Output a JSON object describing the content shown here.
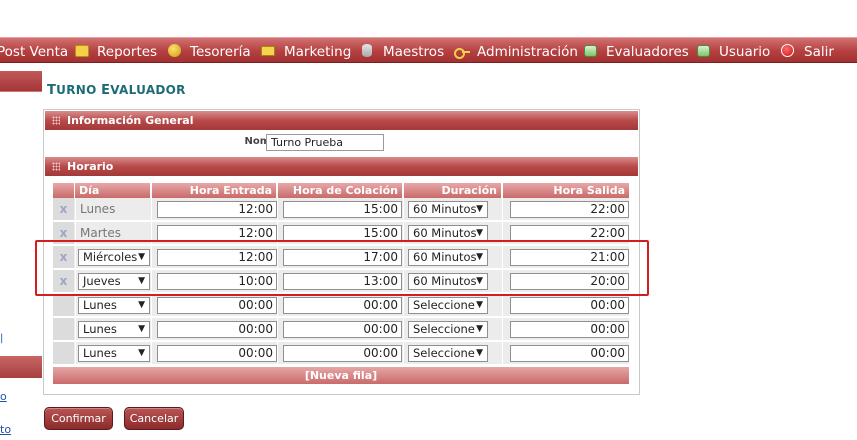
{
  "menu": [
    {
      "label": "Post Venta",
      "icon": "post-venta-icon"
    },
    {
      "label": "Reportes",
      "icon": "folder-icon"
    },
    {
      "label": "Tesorería",
      "icon": "coin-icon"
    },
    {
      "label": "Marketing",
      "icon": "marketing-icon"
    },
    {
      "label": "Maestros",
      "icon": "database-icon"
    },
    {
      "label": "Administración",
      "icon": "key-icon"
    },
    {
      "label": "Evaluadores",
      "icon": "evaluator-icon"
    },
    {
      "label": "Usuario",
      "icon": "user-icon"
    },
    {
      "label": "Salir",
      "icon": "exit-icon"
    }
  ],
  "sidebar": {
    "link1": "o",
    "link2": "to",
    "tick": "|"
  },
  "page": {
    "title_first": "T",
    "title_rest": "URNO",
    "title_first2": "E",
    "title_rest2": "VALUADOR"
  },
  "general": {
    "header": "Información General",
    "nombre_label": "Nombre",
    "nombre_value": "Turno Prueba"
  },
  "horario": {
    "header": "Horario",
    "columns": {
      "dia": "Día",
      "entrada": "Hora Entrada",
      "colacion": "Hora de Colación",
      "duracion": "Duración colación",
      "salida": "Hora Salida"
    },
    "remove_symbol": "x",
    "rows": [
      {
        "removable": true,
        "day_select": false,
        "day": "Lunes",
        "entrada": "12:00",
        "colacion": "15:00",
        "duracion": "60 Minutos",
        "salida": "22:00"
      },
      {
        "removable": true,
        "day_select": false,
        "day": "Martes",
        "entrada": "12:00",
        "colacion": "15:00",
        "duracion": "60 Minutos",
        "salida": "22:00"
      },
      {
        "removable": true,
        "day_select": true,
        "day": "Miércoles",
        "entrada": "12:00",
        "colacion": "17:00",
        "duracion": "60 Minutos",
        "salida": "21:00"
      },
      {
        "removable": true,
        "day_select": true,
        "day": "Jueves",
        "entrada": "10:00",
        "colacion": "13:00",
        "duracion": "60 Minutos",
        "salida": "20:00"
      },
      {
        "removable": false,
        "day_select": true,
        "day": "Lunes",
        "entrada": "00:00",
        "colacion": "00:00",
        "duracion": "Seleccione",
        "salida": "00:00"
      },
      {
        "removable": false,
        "day_select": true,
        "day": "Lunes",
        "entrada": "00:00",
        "colacion": "00:00",
        "duracion": "Seleccione",
        "salida": "00:00"
      },
      {
        "removable": false,
        "day_select": true,
        "day": "Lunes",
        "entrada": "00:00",
        "colacion": "00:00",
        "duracion": "Seleccione",
        "salida": "00:00"
      }
    ],
    "new_row": "[Nueva fila]"
  },
  "actions": {
    "confirm": "Confirmar",
    "cancel": "Cancelar"
  },
  "colors": {
    "menu": "#b54040",
    "title": "#1c6b77",
    "highlight": "#d11f1f",
    "button": "#8c2b2b"
  },
  "dropdown_arrow": "▼"
}
